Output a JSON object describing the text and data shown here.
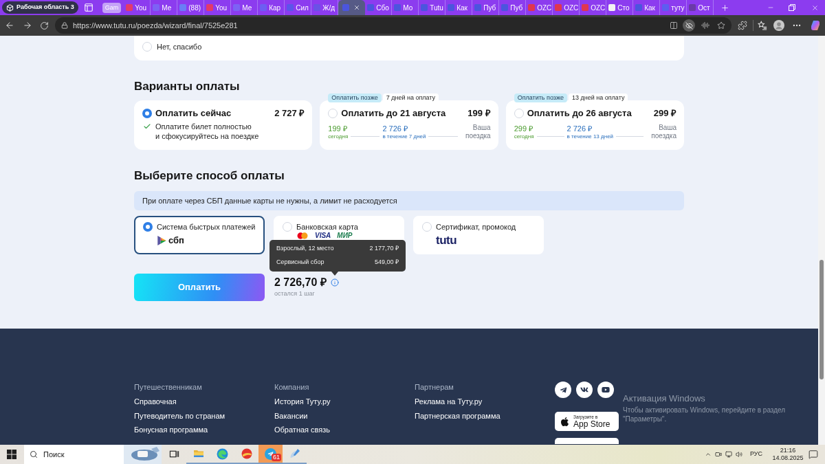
{
  "browser": {
    "workspace": "Рабочая область 3",
    "tabs": [
      {
        "kind": "group",
        "label": "Gam"
      },
      {
        "kind": "tab",
        "label": "You",
        "selected": false,
        "color": "#e33a6a"
      },
      {
        "kind": "tab",
        "label": "Ме",
        "selected": false,
        "color": "#7d62f5"
      },
      {
        "kind": "tab",
        "label": "(88)",
        "selected": false,
        "color": "#6a7df6"
      },
      {
        "kind": "tab",
        "label": "You",
        "selected": false,
        "color": "#e33a6a"
      },
      {
        "kind": "tab",
        "label": "Ме",
        "selected": false,
        "color": "#7d62f5"
      },
      {
        "kind": "tab",
        "label": "Кар",
        "selected": false,
        "color": "#6d5ef2"
      },
      {
        "kind": "tab",
        "label": "Сил",
        "selected": false,
        "color": "#5c55ea"
      },
      {
        "kind": "tab",
        "label": "Ж/д",
        "selected": false,
        "color": "#6a52e6"
      },
      {
        "kind": "tab",
        "selected": true,
        "color": "#4b55de"
      },
      {
        "kind": "tab",
        "label": "Сбо",
        "selected": false,
        "color": "#4b55de"
      },
      {
        "kind": "tab",
        "label": "Мо",
        "selected": false,
        "color": "#4b55de"
      },
      {
        "kind": "tab",
        "label": "Tutu",
        "selected": false,
        "color": "#4b55de"
      },
      {
        "kind": "tab",
        "label": "Как",
        "selected": false,
        "color": "#4b55de"
      },
      {
        "kind": "tab",
        "label": "Пуб",
        "selected": false,
        "color": "#4b55de"
      },
      {
        "kind": "tab",
        "label": "Пуб",
        "selected": false,
        "color": "#4b55de"
      },
      {
        "kind": "tab",
        "label": "OZC",
        "selected": false,
        "color": "#e0364f"
      },
      {
        "kind": "tab",
        "label": "OZC",
        "selected": false,
        "color": "#e0364f"
      },
      {
        "kind": "tab",
        "label": "OZC",
        "selected": false,
        "color": "#e0364f"
      },
      {
        "kind": "tab",
        "label": "Сто",
        "selected": false,
        "color": "#f2f2f2"
      },
      {
        "kind": "tab",
        "label": "Как",
        "selected": false,
        "color": "#4b55de"
      },
      {
        "kind": "tab",
        "label": "туту",
        "selected": false,
        "color": "#5d5df0"
      },
      {
        "kind": "tab",
        "label": "Ост",
        "selected": false,
        "color": "#6b3aa8"
      }
    ],
    "url": "https://www.tutu.ru/poezda/wizard/final/7525e281"
  },
  "consent": {
    "options": [
      {
        "label": "Нет, спасибо",
        "selected": false
      }
    ]
  },
  "payment_variants": {
    "title": "Варианты оплаты",
    "options": [
      {
        "kind": "now",
        "selected": true,
        "title": "Оплатить сейчас",
        "price": "2 727 ₽",
        "note": "Оплатите билет полностью\nи сфокусируйтесь на поездке"
      },
      {
        "kind": "later",
        "selected": false,
        "tags": [
          {
            "kind": "accent",
            "text": "Оплатить позже"
          },
          {
            "kind": "plain",
            "text": "7 дней на оплату"
          }
        ],
        "title": "Оплатить до 21 августа",
        "price": "199 ₽",
        "steps": [
          {
            "kind": "now",
            "amount": "199 ₽",
            "label": "сегодня"
          },
          {
            "kind": "later",
            "amount": "2 726 ₽",
            "label": "в течение 7 дней"
          }
        ],
        "destination": "Ваша поездка"
      },
      {
        "kind": "later",
        "selected": false,
        "tags": [
          {
            "kind": "accent",
            "text": "Оплатить позже"
          },
          {
            "kind": "plain",
            "text": "13 дней на оплату"
          }
        ],
        "title": "Оплатить до 26 августа",
        "price": "299 ₽",
        "steps": [
          {
            "kind": "now",
            "amount": "299 ₽",
            "label": "сегодня"
          },
          {
            "kind": "later",
            "amount": "2 726 ₽",
            "label": "в течение 13 дней"
          }
        ],
        "destination": "Ваша поездка"
      }
    ]
  },
  "payment_methods": {
    "title": "Выберите способ оплаты",
    "notice": "При оплате через СБП данные карты не нужны, а лимит не расходуется",
    "options": [
      {
        "kind": "sbp",
        "selected": true,
        "label": "Система быстрых платежей",
        "logos": [
          {
            "text": "сбп",
            "color": "#111111"
          }
        ]
      },
      {
        "kind": "card",
        "selected": false,
        "label": "Банковская карта",
        "logos": [
          {
            "text": "VISA",
            "color": "#1b2a80"
          },
          {
            "text": "МИР",
            "color": "#177a4b"
          }
        ]
      },
      {
        "kind": "certificate",
        "selected": false,
        "label": "Сертификат, промокод",
        "logos": [
          {
            "text": "tutu",
            "color": "#1d2466"
          }
        ]
      }
    ]
  },
  "checkout": {
    "button": "Оплатить",
    "total": "2 726,70 ₽",
    "hint": "остался 1 шаг",
    "breakdown": [
      {
        "label": "Взрослый, 12 место",
        "amount": "2 177,70 ₽"
      },
      {
        "label": "Сервисный сбор",
        "amount": "549,00 ₽"
      }
    ]
  },
  "footer": {
    "columns": [
      {
        "title": "Путешественникам",
        "links": [
          "Справочная",
          "Путеводитель по странам",
          "Бонусная программа"
        ]
      },
      {
        "title": "Компания",
        "links": [
          "История Туту.ру",
          "Вакансии",
          "Обратная связь"
        ]
      },
      {
        "title": "Партнерам",
        "links": [
          "Реклама на Туту.ру",
          "Партнерская программа"
        ]
      }
    ],
    "app_store": {
      "caption": "Загрузите в",
      "name": "App Store"
    }
  },
  "windows_notice": {
    "title": "Активация Windows",
    "text": "Чтобы активировать Windows, перейдите в раздел \"Параметры\"."
  },
  "taskbar": {
    "search_placeholder": "Поиск",
    "apps": [
      {
        "running": false,
        "highlighted": false
      },
      {
        "running": true,
        "highlighted": false
      },
      {
        "running": true,
        "highlighted": false
      },
      {
        "running": true,
        "highlighted": false
      },
      {
        "running": true,
        "highlighted": true,
        "badge": "61"
      },
      {
        "running": true,
        "highlighted": false
      }
    ],
    "language": "РУС",
    "time": "21:16",
    "date": "14.08.2025"
  }
}
